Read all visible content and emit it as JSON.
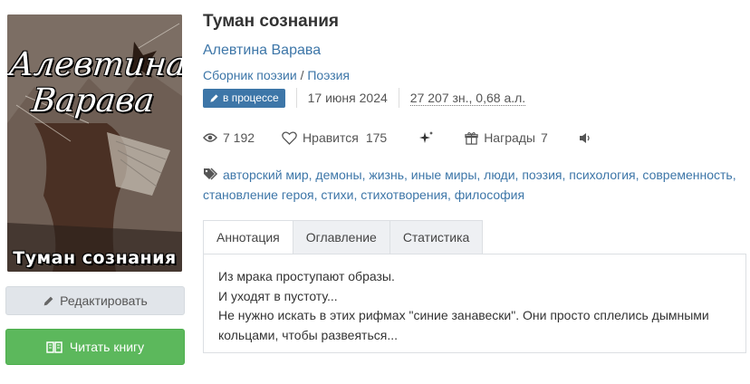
{
  "book": {
    "cover_author": "Алевтина Варава",
    "cover_title": "Туман сознания",
    "title": "Туман сознания",
    "author": "Алевтина Варава",
    "collection": "Сборник поэзии",
    "genre_sep": "/",
    "genre": "Поэзия",
    "status": "в процессе",
    "date": "17 июня 2024",
    "size": "27 207 зн., 0,68 а.л."
  },
  "stats": {
    "views": "7 192",
    "likes_label": "Нравится",
    "likes": "175",
    "awards_label": "Награды",
    "awards": "7"
  },
  "tags": [
    "авторский мир",
    "демоны",
    "жизнь",
    "иные миры",
    "люди",
    "поэзия",
    "психология",
    "современность",
    "становление героя",
    "стихи",
    "стихотворения",
    "философия"
  ],
  "tabs": [
    "Аннотация",
    "Оглавление",
    "Статистика"
  ],
  "annotation": [
    "Из мрака проступают образы.",
    "И уходят в пустоту...",
    "Не нужно искать в этих рифмах \"синие занавески\". Они просто сплелись дымными",
    "кольцами, чтобы развеяться..."
  ],
  "buttons": {
    "edit": "Редактировать",
    "read": "Читать книгу"
  },
  "colors": {
    "link": "#3d76a8",
    "read_button": "#5cb85c",
    "edit_button": "#e1e5ea"
  }
}
